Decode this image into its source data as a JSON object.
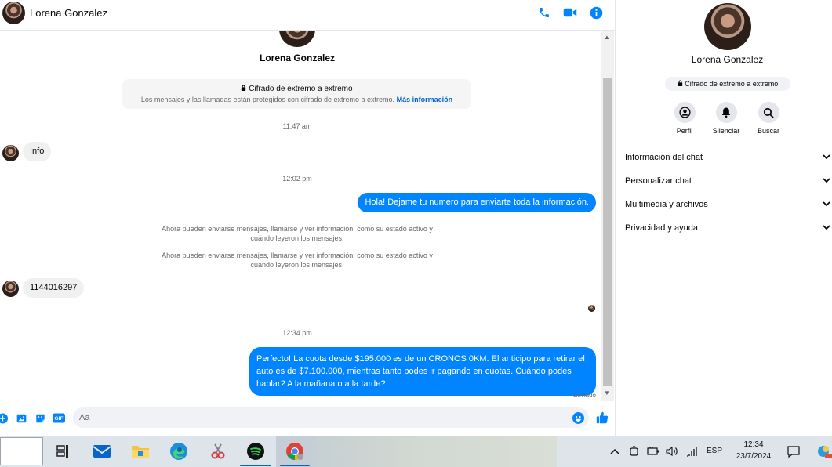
{
  "header": {
    "contact_name": "Lorena Gonzalez",
    "icons": [
      "phone-icon",
      "video-icon",
      "info-icon"
    ]
  },
  "conversation": {
    "contact_name": "Lorena Gonzalez",
    "encryption": {
      "title": "Cifrado de extremo a extremo",
      "text": "Los mensajes y las llamadas están protegidos con cifrado de extremo a extremo.",
      "link": "Más información"
    },
    "times": [
      "11:47 am",
      "12:02 pm",
      "12:34 pm"
    ],
    "messages": [
      {
        "direction": "in",
        "text": "Info"
      },
      {
        "direction": "out",
        "text": "Hola! Dejame tu numero  para enviarte toda la información."
      },
      {
        "direction": "in",
        "text": "1144016297"
      },
      {
        "direction": "out",
        "text": "Perfecto! La cuota desde $195.000 es de un CRONOS 0KM. El anticipo para retirar el auto es de $7.100.000, mientras tanto podes ir pagando en cuotas. Cuándo podes hablar? A la mañana o a la tarde?"
      }
    ],
    "system_notices": [
      "Ahora pueden enviarse mensajes, llamarse y ver información, como su estado activo y cuándo leyeron los mensajes.",
      "Ahora pueden enviarse mensajes, llamarse y ver información, como su estado activo y cuándo leyeron los mensajes."
    ],
    "status": "Enviado"
  },
  "composer": {
    "placeholder": "Aa",
    "value": "",
    "icons": [
      "plus-icon",
      "image-icon",
      "sticker-icon",
      "gif-icon",
      "emoji-icon",
      "like-icon"
    ],
    "gif_label": "GIF"
  },
  "info_panel": {
    "name": "Lorena Gonzalez",
    "badge": "Cifrado de extremo a extremo",
    "actions": [
      {
        "label": "Perfil",
        "icon": "profile-icon"
      },
      {
        "label": "Silenciar",
        "icon": "bell-icon"
      },
      {
        "label": "Buscar",
        "icon": "search-icon"
      }
    ],
    "sections": [
      "Información del chat",
      "Personalizar chat",
      "Multimedia y archivos",
      "Privacidad y ayuda"
    ]
  },
  "taskbar": {
    "apps": [
      "task-view-icon",
      "mail-icon",
      "file-explorer-icon",
      "edge-icon",
      "snipping-tool-icon",
      "spotify-icon",
      "chrome-icon"
    ],
    "language": "ESP",
    "time": "12:34",
    "date": "23/7/2024"
  },
  "colors": {
    "accent": "#0084ff",
    "link": "#0064d1",
    "incoming_bubble": "#f0f0f0"
  }
}
